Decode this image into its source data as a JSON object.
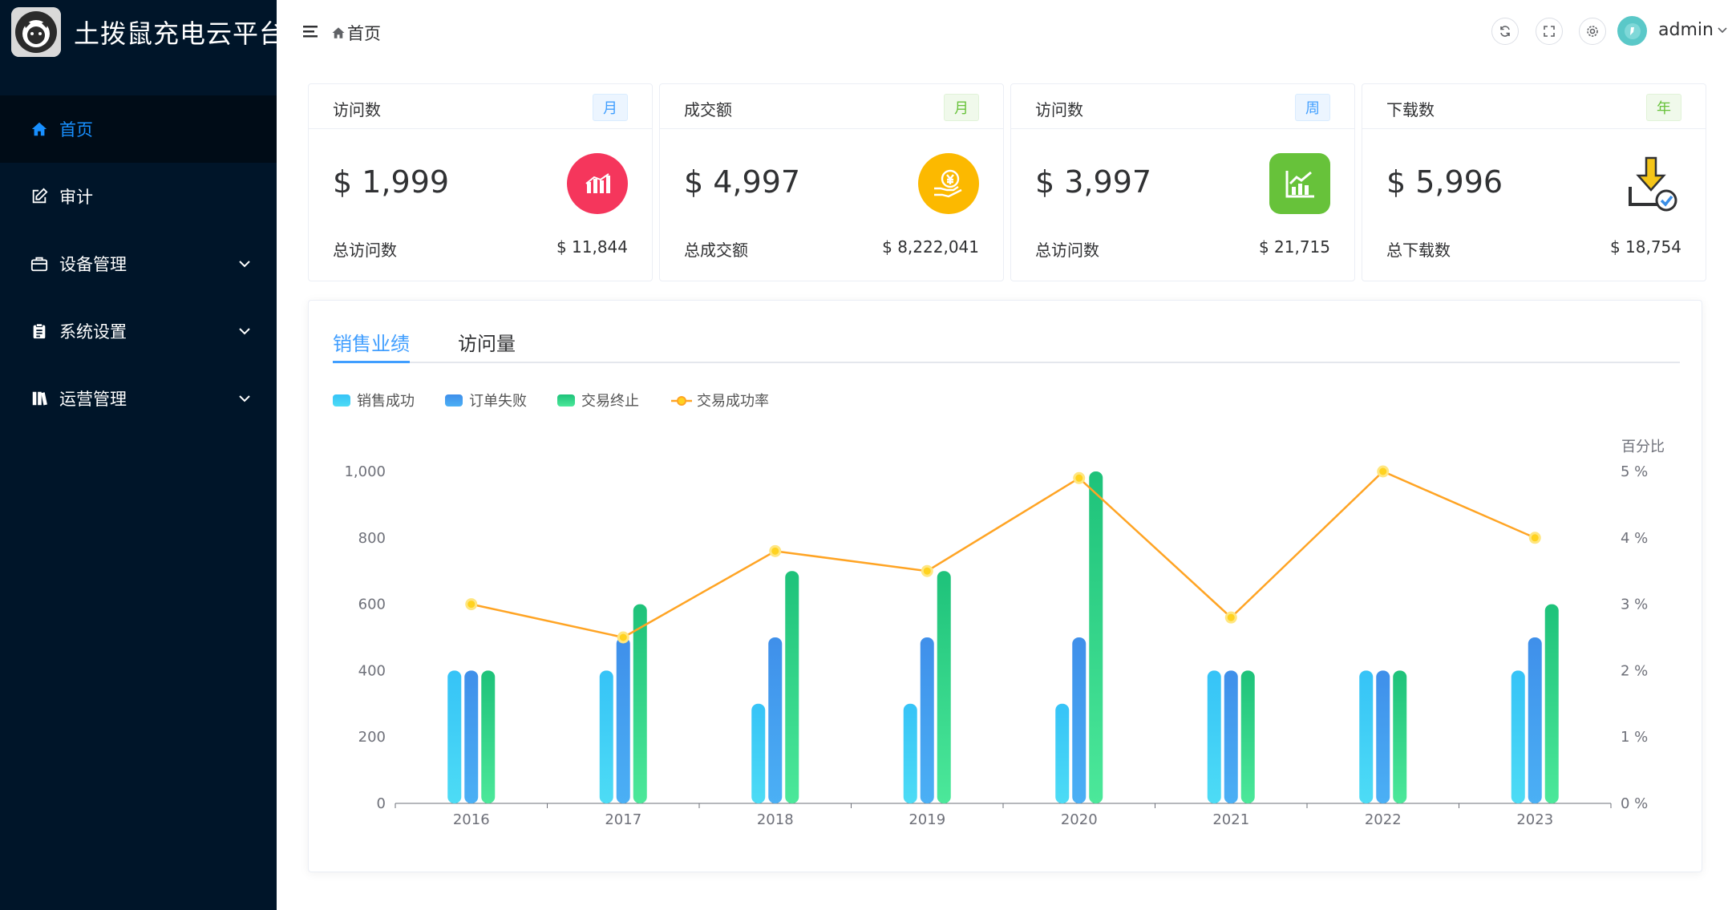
{
  "app": {
    "title": "土拨鼠充电云平台"
  },
  "sidebar": {
    "items": [
      {
        "label": "首页",
        "icon": "home-icon",
        "active": true
      },
      {
        "label": "审计",
        "icon": "edit-icon",
        "active": false
      },
      {
        "label": "设备管理",
        "icon": "briefcase-icon",
        "active": false,
        "has_children": true
      },
      {
        "label": "系统设置",
        "icon": "clipboard-icon",
        "active": false,
        "has_children": true
      },
      {
        "label": "运营管理",
        "icon": "books-icon",
        "active": false,
        "has_children": true
      }
    ]
  },
  "header": {
    "breadcrumb": "首页",
    "username": "admin",
    "actions": [
      "refresh-icon",
      "fullscreen-icon",
      "settings-icon"
    ]
  },
  "cards": [
    {
      "title": "访问数",
      "tag": "月",
      "tag_type": "blue",
      "value": "$ 1,999",
      "footer_label": "总访问数",
      "footer_value": "$ 11,844",
      "icon": "bar-chart-icon",
      "icon_color": "#f5365c"
    },
    {
      "title": "成交额",
      "tag": "月",
      "tag_type": "green",
      "value": "$ 4,997",
      "footer_label": "总成交额",
      "footer_value": "$ 8,222,041",
      "icon": "yen-coin-hand-icon",
      "icon_color": "#fcb900"
    },
    {
      "title": "访问数",
      "tag": "周",
      "tag_type": "blue",
      "value": "$ 3,997",
      "footer_label": "总访问数",
      "footer_value": "$ 21,715",
      "icon": "line-chart-icon",
      "icon_color": "#67c23a"
    },
    {
      "title": "下载数",
      "tag": "年",
      "tag_type": "green",
      "value": "$ 5,996",
      "footer_label": "总下载数",
      "footer_value": "$ 18,754",
      "icon": "download-check-icon",
      "icon_color": "#f5c518"
    }
  ],
  "tabs": [
    {
      "label": "销售业绩",
      "active": true
    },
    {
      "label": "访问量",
      "active": false
    }
  ],
  "chart_data": {
    "type": "bar",
    "categories": [
      "2016",
      "2017",
      "2018",
      "2019",
      "2020",
      "2021",
      "2022",
      "2023"
    ],
    "series": [
      {
        "name": "销售成功",
        "type": "bar",
        "color": "#36c3f7",
        "values": [
          400,
          400,
          300,
          300,
          300,
          400,
          400,
          400
        ]
      },
      {
        "name": "订单失败",
        "type": "bar",
        "color": "#3f8fea",
        "values": [
          400,
          500,
          500,
          500,
          500,
          400,
          400,
          500
        ]
      },
      {
        "name": "交易终止",
        "type": "bar",
        "color": "#1ec27a",
        "values": [
          400,
          600,
          700,
          700,
          1000,
          400,
          400,
          600
        ]
      },
      {
        "name": "交易成功率",
        "type": "line",
        "axis": "right",
        "color": "#ffa424",
        "values": [
          3,
          2.5,
          3.8,
          3.5,
          4.9,
          2.8,
          5,
          4
        ]
      }
    ],
    "ylim": [
      0,
      1000
    ],
    "y_ticks": [
      "0",
      "200",
      "400",
      "600",
      "800",
      "1,000"
    ],
    "y2label": "百分比",
    "y2lim": [
      0,
      5
    ],
    "y2_ticks": [
      "0 %",
      "1 %",
      "2 %",
      "3 %",
      "4 %",
      "5 %"
    ],
    "legend": "top-left",
    "grid": false
  }
}
